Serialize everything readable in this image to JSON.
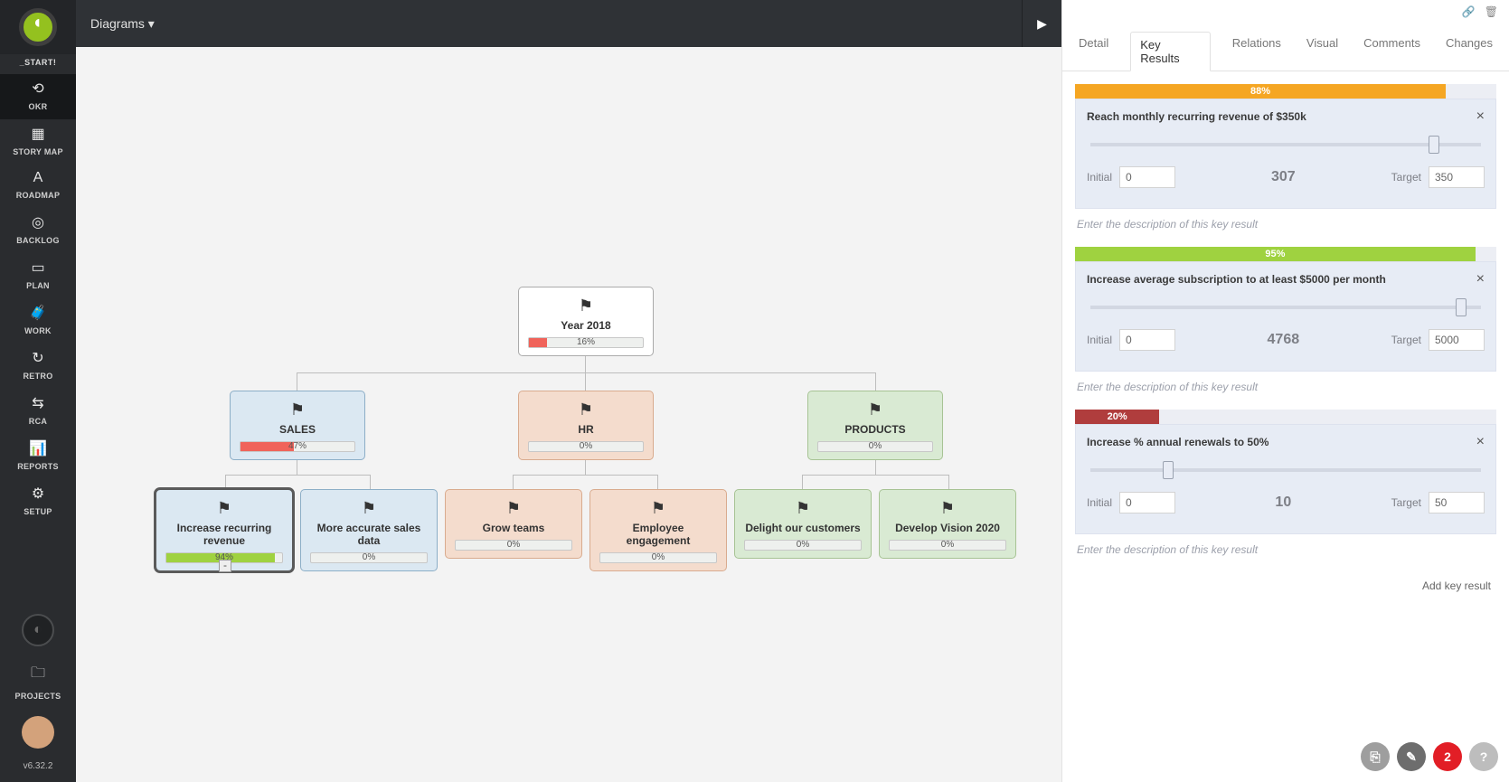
{
  "app": {
    "start_label": "_START!",
    "version": "v6.32.2"
  },
  "sidebar": {
    "items": [
      {
        "icon": "⟲",
        "label": "OKR",
        "name": "nav-okr"
      },
      {
        "icon": "▦",
        "label": "STORY MAP",
        "name": "nav-storymap"
      },
      {
        "icon": "A",
        "label": "ROADMAP",
        "name": "nav-roadmap"
      },
      {
        "icon": "◎",
        "label": "BACKLOG",
        "name": "nav-backlog"
      },
      {
        "icon": "▭",
        "label": "PLAN",
        "name": "nav-plan"
      },
      {
        "icon": "🧳",
        "label": "WORK",
        "name": "nav-work"
      },
      {
        "icon": "↻",
        "label": "RETRO",
        "name": "nav-retro"
      },
      {
        "icon": "⇆",
        "label": "RCA",
        "name": "nav-rca"
      },
      {
        "icon": "📊",
        "label": "REPORTS",
        "name": "nav-reports"
      },
      {
        "icon": "⚙",
        "label": "SETUP",
        "name": "nav-setup"
      }
    ],
    "projects_label": "PROJECTS"
  },
  "topbar": {
    "menu_label": "Diagrams ▾"
  },
  "tree": {
    "root": {
      "title": "Year 2018",
      "percent": "16%",
      "fill_pct": 16
    },
    "row2": [
      {
        "title": "SALES",
        "percent": "47%",
        "fill_pct": 47,
        "theme": "blue"
      },
      {
        "title": "HR",
        "percent": "0%",
        "fill_pct": 0,
        "theme": "peach"
      },
      {
        "title": "PRODUCTS",
        "percent": "0%",
        "fill_pct": 0,
        "theme": "green"
      }
    ],
    "row3": [
      {
        "title": "Increase recurring revenue",
        "percent": "94%",
        "fill_pct": 94,
        "theme": "blue",
        "selected": true,
        "fillcolor": "green"
      },
      {
        "title": "More accurate sales data",
        "percent": "0%",
        "fill_pct": 0,
        "theme": "blue"
      },
      {
        "title": "Grow teams",
        "percent": "0%",
        "fill_pct": 0,
        "theme": "peach"
      },
      {
        "title": "Employee engagement",
        "percent": "0%",
        "fill_pct": 0,
        "theme": "peach"
      },
      {
        "title": "Delight our customers",
        "percent": "0%",
        "fill_pct": 0,
        "theme": "green"
      },
      {
        "title": "Develop Vision 2020",
        "percent": "0%",
        "fill_pct": 0,
        "theme": "green"
      }
    ]
  },
  "panel": {
    "tabs": [
      "Detail",
      "Key Results",
      "Relations",
      "Visual",
      "Comments",
      "Changes"
    ],
    "active_tab": 1,
    "key_results": [
      {
        "percent_text": "88%",
        "bar_pct": 88,
        "bar_color": "orange",
        "title": "Reach monthly recurring revenue of $350k",
        "initial_label": "Initial",
        "initial_val": "0",
        "current": "307",
        "target_label": "Target",
        "target_val": "350",
        "slider_pct": 88,
        "desc_placeholder": "Enter the description of this key result"
      },
      {
        "percent_text": "95%",
        "bar_pct": 95,
        "bar_color": "lime",
        "title": "Increase average subscription to at least $5000 per month",
        "initial_label": "Initial",
        "initial_val": "0",
        "current": "4768",
        "target_label": "Target",
        "target_val": "5000",
        "slider_pct": 95,
        "desc_placeholder": "Enter the description of this key result"
      },
      {
        "percent_text": "20%",
        "bar_pct": 20,
        "bar_color": "dred",
        "title": "Increase % annual renewals to 50%",
        "initial_label": "Initial",
        "initial_val": "0",
        "current": "10",
        "target_label": "Target",
        "target_val": "50",
        "slider_pct": 20,
        "desc_placeholder": "Enter the description of this key result"
      }
    ],
    "add_label": "Add key result",
    "notif_count": "2"
  }
}
